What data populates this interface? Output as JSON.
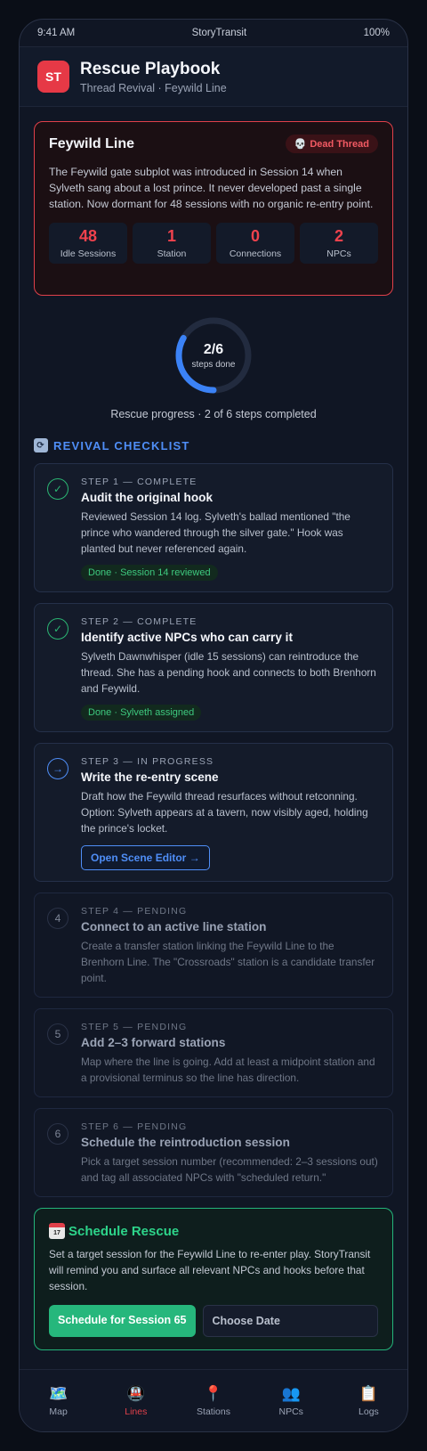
{
  "status_bar": {
    "time": "9:41 AM",
    "app": "StoryTransit",
    "battery": "100%"
  },
  "header": {
    "logo": "ST",
    "title": "Rescue Playbook",
    "subtitle": "Thread Revival · Feywild Line"
  },
  "dead_card": {
    "title": "Feywild Line",
    "badge": "Dead Thread",
    "badge_icon": "skull-icon",
    "description": "The Feywild gate subplot was introduced in Session 14 when Sylveth sang about a lost prince. It never developed past a single station. Now dormant for 48 sessions with no organic re-entry point.",
    "stats": [
      {
        "value": "48",
        "label": "Idle Sessions"
      },
      {
        "value": "1",
        "label": "Station"
      },
      {
        "value": "0",
        "label": "Connections"
      },
      {
        "value": "2",
        "label": "NPCs"
      }
    ]
  },
  "progress": {
    "ring_value": "2/6",
    "ring_label": "steps done",
    "fraction": 0.333,
    "text": "Rescue progress · 2 of 6 steps completed"
  },
  "checklist": {
    "title": "REVIVAL CHECKLIST",
    "steps": [
      {
        "label": "STEP 1 — COMPLETE",
        "title": "Audit the original hook",
        "desc": "Reviewed Session 14 log. Sylveth's ballad mentioned \"the prince who wandered through the silver gate.\" Hook was planted but never referenced again.",
        "tag": "Done · Session 14 reviewed"
      },
      {
        "label": "STEP 2 — COMPLETE",
        "title": "Identify active NPCs who can carry it",
        "desc": "Sylveth Dawnwhisper (idle 15 sessions) can reintroduce the thread. She has a pending hook and connects to both Brenhorn and Feywild.",
        "tag": "Done · Sylveth assigned"
      },
      {
        "label": "STEP 3 — IN PROGRESS",
        "title": "Write the re-entry scene",
        "desc": "Draft how the Feywild thread resurfaces without retconning. Option: Sylveth appears at a tavern, now visibly aged, holding the prince's locket.",
        "button": "Open Scene Editor →"
      },
      {
        "number": "4",
        "label": "STEP 4 — PENDING",
        "title": "Connect to an active line station",
        "desc": "Create a transfer station linking the Feywild Line to the Brenhorn Line. The \"Crossroads\" station is a candidate transfer point."
      },
      {
        "number": "5",
        "label": "STEP 5 — PENDING",
        "title": "Add 2–3 forward stations",
        "desc": "Map where the line is going. Add at least a midpoint station and a provisional terminus so the line has direction."
      },
      {
        "number": "6",
        "label": "STEP 6 — PENDING",
        "title": "Schedule the reintroduction session",
        "desc": "Pick a target session number (recommended: 2–3 sessions out) and tag all associated NPCs with \"scheduled return.\""
      }
    ]
  },
  "schedule": {
    "title": "Schedule Rescue",
    "desc": "Set a target session for the Feywild Line to re-enter play. StoryTransit will remind you and surface all relevant NPCs and hooks before that session.",
    "primary_label": "Schedule for Session 65",
    "secondary_label": "Choose Date"
  },
  "tabs": [
    {
      "label": "Map",
      "icon": "map-icon"
    },
    {
      "label": "Lines",
      "icon": "train-icon",
      "active": true
    },
    {
      "label": "Stations",
      "icon": "pin-icon"
    },
    {
      "label": "NPCs",
      "icon": "people-icon"
    },
    {
      "label": "Logs",
      "icon": "clipboard-icon"
    }
  ],
  "colors": {
    "danger": "#e0404a",
    "accent": "#4f8ef7",
    "success": "#26b77c"
  }
}
